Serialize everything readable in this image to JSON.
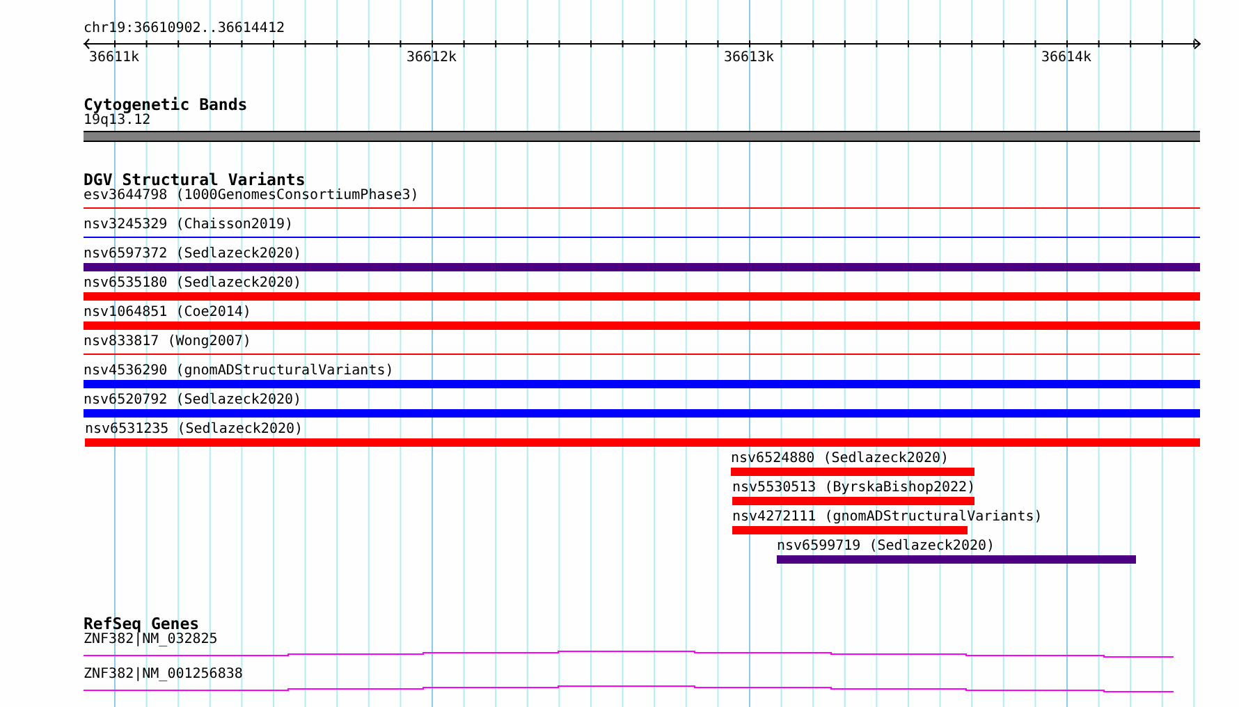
{
  "ruler": {
    "region": "chr19:36610902..36614412",
    "ticks": [
      "36611k",
      "36612k",
      "36613k",
      "36614k"
    ]
  },
  "tracks": [
    {
      "title": "Cytogenetic Bands",
      "kind": "cytoband",
      "features": [
        {
          "label": "19q13.12"
        }
      ]
    },
    {
      "title": "DGV Structural Variants",
      "kind": "variants",
      "features": [
        {
          "label": "esv3644798 (1000GenomesConsortiumPhase3)",
          "color": "#ff0000",
          "kind": "line"
        },
        {
          "label": "nsv3245329 (Chaisson2019)",
          "color": "#0000ff",
          "kind": "line"
        },
        {
          "label": "nsv6597372 (Sedlazeck2020)",
          "color": "#4b0082",
          "kind": "bar"
        },
        {
          "label": "nsv6535180 (Sedlazeck2020)",
          "color": "#ff0000",
          "kind": "bar"
        },
        {
          "label": "nsv1064851 (Coe2014)",
          "color": "#ff0000",
          "kind": "bar"
        },
        {
          "label": "nsv833817 (Wong2007)",
          "color": "#ff0000",
          "kind": "line"
        },
        {
          "label": "nsv4536290 (gnomADStructuralVariants)",
          "color": "#0000ff",
          "kind": "bar"
        },
        {
          "label": "nsv6520792 (Sedlazeck2020)",
          "color": "#0000ff",
          "kind": "bar"
        },
        {
          "label": "nsv6531235 (Sedlazeck2020)",
          "color": "#ff0000",
          "kind": "bar"
        },
        {
          "label": "nsv6524880 (Sedlazeck2020)",
          "color": "#ff0000",
          "kind": "bar"
        },
        {
          "label": "nsv5530513 (ByrskaBishop2022)",
          "color": "#ff0000",
          "kind": "bar"
        },
        {
          "label": "nsv4272111 (gnomADStructuralVariants)",
          "color": "#ff0000",
          "kind": "bar"
        },
        {
          "label": "nsv6599719 (Sedlazeck2020)",
          "color": "#4b0082",
          "kind": "bar"
        }
      ]
    },
    {
      "title": "RefSeq Genes",
      "kind": "genes",
      "features": [
        {
          "label": "ZNF382|NM_032825"
        },
        {
          "label": "ZNF382|NM_001256838"
        }
      ]
    }
  ]
}
